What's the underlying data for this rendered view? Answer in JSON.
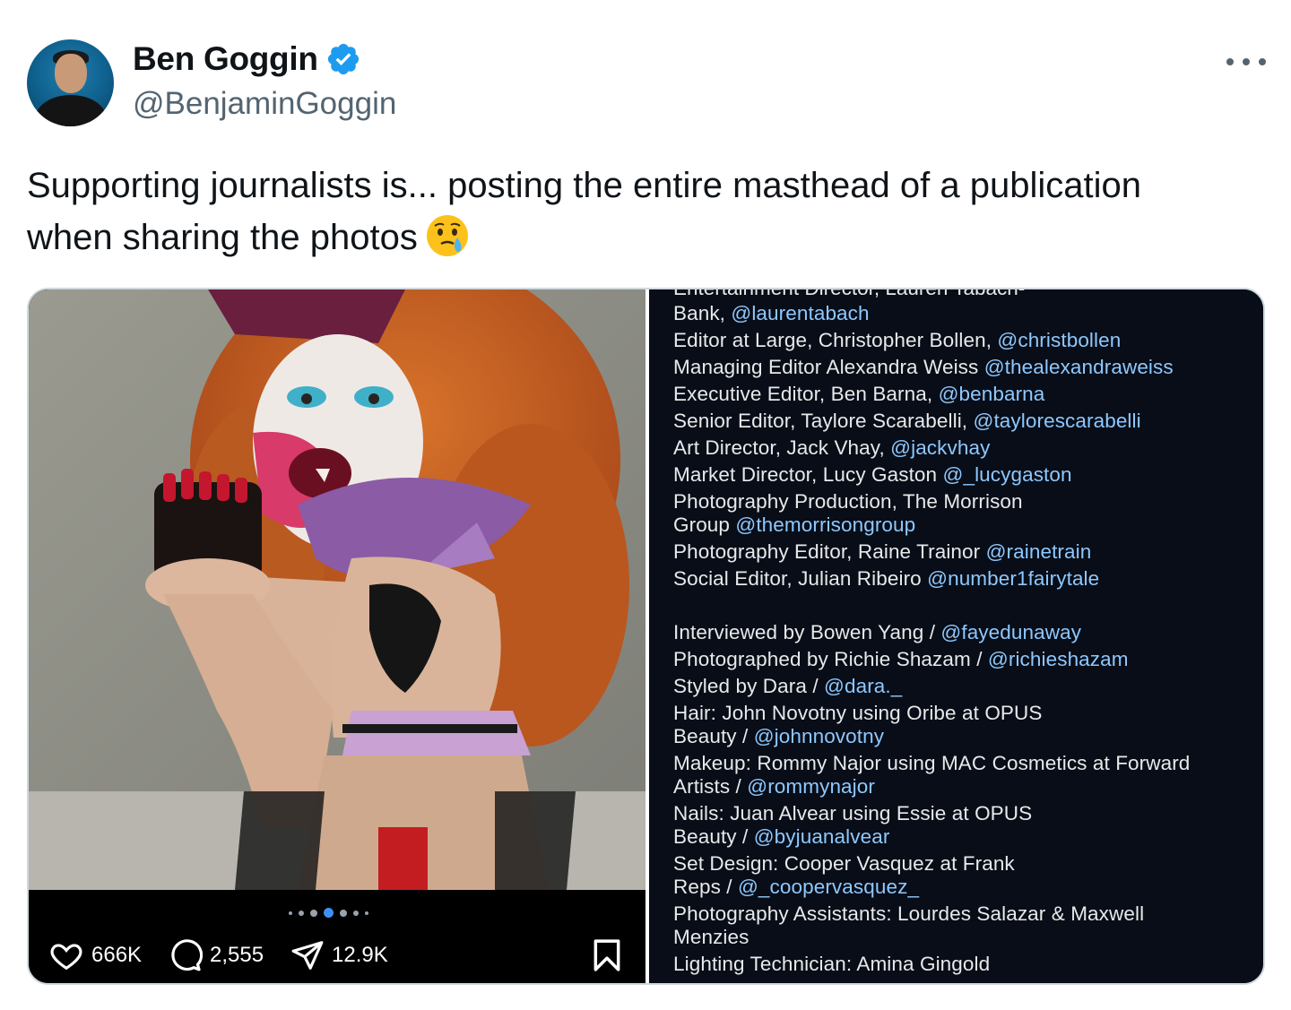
{
  "author": {
    "name": "Ben Goggin",
    "handle": "@BenjaminGoggin",
    "verified": true
  },
  "tweet": {
    "line1": "Supporting journalists is... posting the entire masthead of a publication",
    "line2": "when sharing the photos",
    "emoji": "face-holding-back-tears"
  },
  "media_left": {
    "stats": {
      "likes": "666K",
      "comments": "2,555",
      "shares": "12.9K"
    },
    "carousel": {
      "count": 7,
      "active_index": 3
    }
  },
  "credits": {
    "clipped_first": "Entertainment Director, Lauren Tabach-",
    "lines": [
      {
        "text": "Bank, ",
        "tag": "@laurentabach"
      },
      {
        "text": "Editor at Large, Christopher Bollen, ",
        "tag": "@christbollen"
      },
      {
        "text": "Managing Editor Alexandra Weiss ",
        "tag": "@thealexandraweiss"
      },
      {
        "text": "Executive Editor, Ben Barna, ",
        "tag": "@benbarna"
      },
      {
        "text": "Senior Editor, Taylore Scarabelli, ",
        "tag": "@taylorescarabelli"
      },
      {
        "text": "Art Director, Jack Vhay, ",
        "tag": "@jackvhay"
      },
      {
        "text": "Market Director, Lucy Gaston ",
        "tag": "@_lucygaston"
      },
      {
        "text": "Photography Production, The Morrison",
        "tag": ""
      },
      {
        "text": "Group ",
        "tag": "@themorrisongroup"
      },
      {
        "text": "Photography Editor, Raine Trainor ",
        "tag": "@rainetrain"
      },
      {
        "text": "Social Editor, Julian Ribeiro ",
        "tag": "@number1fairytale"
      },
      {
        "text": "Interviewed by Bowen Yang / ",
        "tag": "@fayedunaway"
      },
      {
        "text": "Photographed by Richie Shazam / ",
        "tag": "@richieshazam"
      },
      {
        "text": "Styled by Dara / ",
        "tag": "@dara._"
      },
      {
        "text": "Hair: John Novotny using Oribe at OPUS",
        "tag": ""
      },
      {
        "text": "Beauty / ",
        "tag": "@johnnovotny"
      },
      {
        "text": "Makeup: Rommy Najor using MAC Cosmetics at Forward",
        "tag": ""
      },
      {
        "text": "Artists / ",
        "tag": "@rommynajor"
      },
      {
        "text": "Nails: Juan Alvear using Essie at OPUS",
        "tag": ""
      },
      {
        "text": "Beauty / ",
        "tag": "@byjuanalvear"
      },
      {
        "text": "Set Design: Cooper Vasquez at Frank",
        "tag": ""
      },
      {
        "text": "Reps / ",
        "tag": "@_coopervasquez_"
      },
      {
        "text": "Photography Assistants: Lourdes Salazar & Maxwell",
        "tag": ""
      },
      {
        "text": "Menzies",
        "tag": ""
      },
      {
        "text": "Lighting Technician: Amina Gingold",
        "tag": ""
      }
    ]
  },
  "colors": {
    "verified": "#1d9bf0",
    "handle_text": "#536471",
    "mention": "#8ec8ff",
    "credits_bg": "#080d17"
  }
}
